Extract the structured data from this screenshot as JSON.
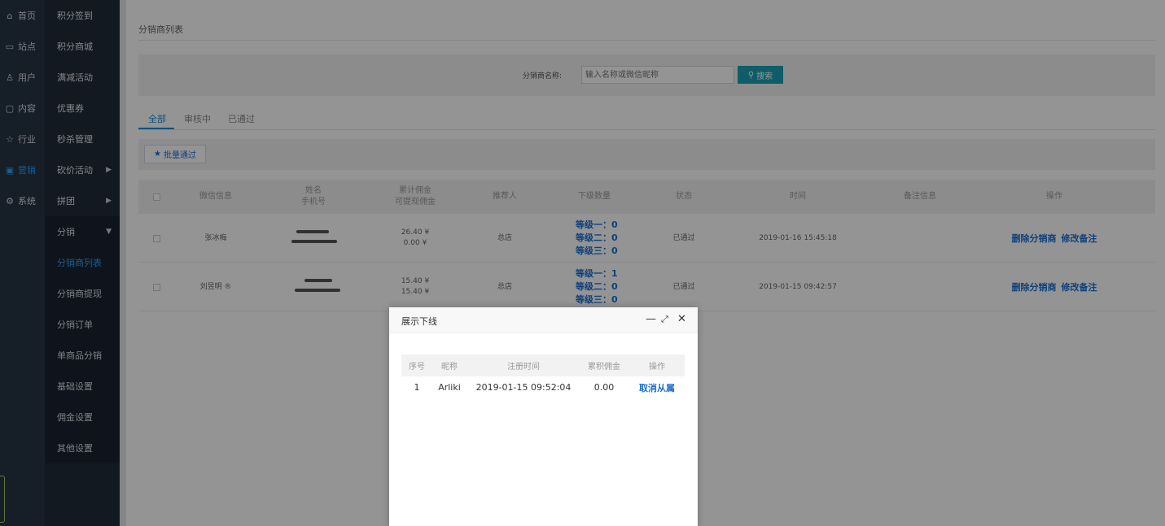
{
  "nav1": {
    "items": [
      {
        "icon": "home-icon",
        "glyph": "⌂",
        "label": "首页"
      },
      {
        "icon": "monitor-icon",
        "glyph": "▭",
        "label": "站点"
      },
      {
        "icon": "user-icon",
        "glyph": "♙",
        "label": "用户"
      },
      {
        "icon": "inbox-icon",
        "glyph": "▢",
        "label": "内容"
      },
      {
        "icon": "star-icon",
        "glyph": "☆",
        "label": "行业"
      },
      {
        "icon": "calendar-icon",
        "glyph": "▣",
        "label": "营销"
      },
      {
        "icon": "gear-icon",
        "glyph": "⚙",
        "label": "系统"
      }
    ]
  },
  "nav2": {
    "items": [
      {
        "label": "积分签到"
      },
      {
        "label": "积分商城"
      },
      {
        "label": "满减活动"
      },
      {
        "label": "优惠券"
      },
      {
        "label": "秒杀管理"
      },
      {
        "label": "砍价活动",
        "arrow": "▶"
      },
      {
        "label": "拼团",
        "arrow": "▶"
      },
      {
        "label": "分销",
        "arrow": "▼"
      }
    ],
    "sub_items": [
      {
        "label": "分销商列表"
      },
      {
        "label": "分销商提现"
      },
      {
        "label": "分销订单"
      },
      {
        "label": "单商品分销"
      },
      {
        "label": "基础设置"
      },
      {
        "label": "佣金设置"
      },
      {
        "label": "其他设置"
      }
    ]
  },
  "page": {
    "title": "分销商列表"
  },
  "search": {
    "label": "分销商名称:",
    "placeholder": "输入名称或微信昵称",
    "button": "搜索"
  },
  "tabs": [
    {
      "label": "全部"
    },
    {
      "label": "审核中"
    },
    {
      "label": "已通过"
    }
  ],
  "toolbar": {
    "batch_label": "批量通过"
  },
  "table": {
    "headers": {
      "wechat": "微信信息",
      "name": "姓名",
      "phone": "手机号",
      "total_commission": "累计佣金",
      "withdrawable": "可提现佣金",
      "referrer": "推荐人",
      "sub_count": "下级数量",
      "status": "状态",
      "time": "时间",
      "remark": "备注信息",
      "ops": "操作"
    },
    "rows": [
      {
        "wechat": "张冰梅",
        "total": "26.40 ¥",
        "withdrawable": "0.00 ¥",
        "referrer": "总店",
        "level1": "等级一：0",
        "level2": "等级二：0",
        "level3": "等级三：0",
        "status": "已通过",
        "time": "2019-01-16 15:45:18",
        "op_delete": "删除分销商",
        "op_edit": "修改备注"
      },
      {
        "wechat": "刘昱明 ®",
        "total": "15.40 ¥",
        "withdrawable": "15.40 ¥",
        "referrer": "总店",
        "level1": "等级一：1",
        "level2": "等级二：0",
        "level3": "等级三：0",
        "status": "已通过",
        "time": "2019-01-15 09:42:57",
        "op_delete": "删除分销商",
        "op_edit": "修改备注"
      }
    ]
  },
  "modal": {
    "title": "展示下线",
    "headers": {
      "seq": "序号",
      "nick": "昵称",
      "reg_time": "注册时间",
      "commission": "累积佣金",
      "ops": "操作"
    },
    "rows": [
      {
        "seq": "1",
        "nick": "Arliki",
        "reg_time": "2019-01-15 09:52:04",
        "commission": "0.00",
        "op": "取消从属"
      }
    ]
  },
  "colors": {
    "accent": "#1b8bd4",
    "link": "#1b6fd4",
    "search_button": "#1aa0b3",
    "nav_bg": "#263445"
  }
}
